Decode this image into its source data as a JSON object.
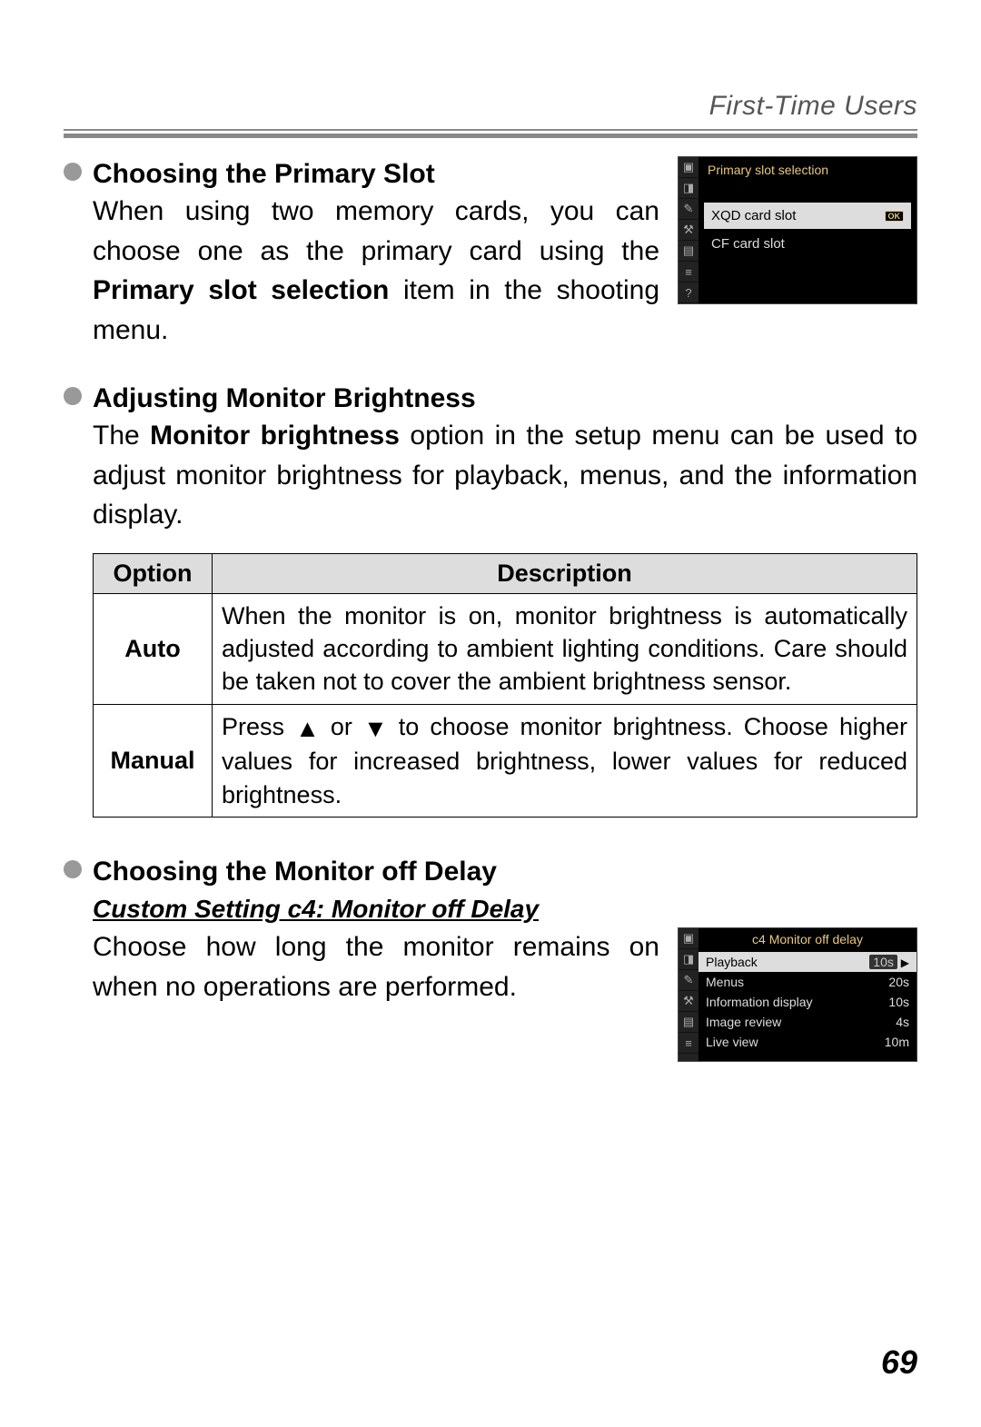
{
  "header": "First-Time Users",
  "page_number": "69",
  "sections": {
    "primary_slot": {
      "title": "Choosing the Primary Slot",
      "text_pre": "When using two memory cards, you can choose one as the primary card using the ",
      "text_bold": "Primary slot selection",
      "text_post": " item in the shooting menu.",
      "cam": {
        "title": "Primary slot selection",
        "item_selected": "XQD card slot",
        "item_other": "CF card slot",
        "ok": "OK"
      }
    },
    "brightness": {
      "title": "Adjusting Monitor Brightness",
      "text_pre": "The ",
      "text_bold": "Monitor brightness",
      "text_post": " option in the setup menu can be used to adjust monitor brightness for playback, menus, and the information display.",
      "table": {
        "header_option": "Option",
        "header_desc": "Description",
        "rows": [
          {
            "option": "Auto",
            "desc": "When the monitor is on, monitor brightness is automatically adjusted according to ambient lighting conditions. Care should be taken not to cover the ambient brightness sensor."
          },
          {
            "option": "Manual",
            "desc_pre": "Press ",
            "desc_mid": " or ",
            "desc_post": " to choose monitor brightness. Choose higher values for increased brightness, lower values for reduced brightness."
          }
        ]
      }
    },
    "monitor_off": {
      "title": "Choosing the Monitor off Delay",
      "subhead": "Custom Setting c4: Monitor off Delay",
      "text": "Choose how long the monitor remains on when no operations are performed.",
      "cam": {
        "title": "c4 Monitor off delay",
        "rows": [
          {
            "label": "Playback",
            "value": "10s",
            "selected": true
          },
          {
            "label": "Menus",
            "value": "20s",
            "selected": false
          },
          {
            "label": "Information display",
            "value": "10s",
            "selected": false
          },
          {
            "label": "Image review",
            "value": "4s",
            "selected": false
          },
          {
            "label": "Live view",
            "value": "10m",
            "selected": false
          }
        ]
      }
    }
  }
}
